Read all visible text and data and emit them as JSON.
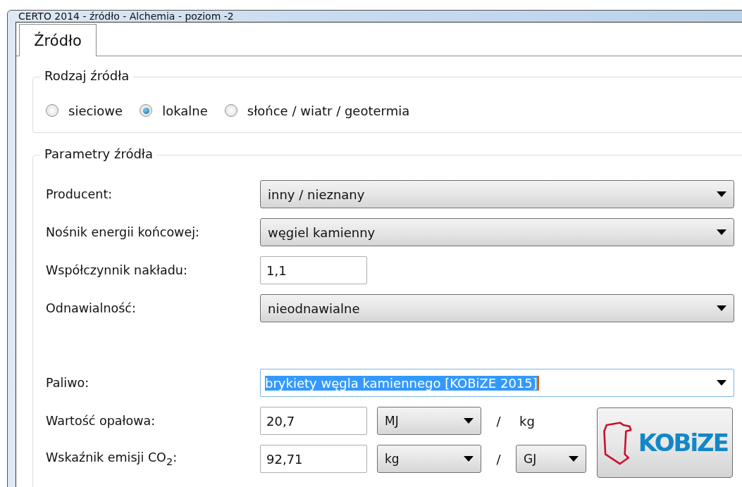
{
  "window": {
    "title": "CERTO 2014 - źródło - Alchemia - poziom -2"
  },
  "tabs": [
    {
      "label": "Źródło",
      "selected": true
    }
  ],
  "source_type": {
    "legend": "Rodzaj źródła",
    "options": [
      {
        "label": "sieciowe",
        "selected": false
      },
      {
        "label": "lokalne",
        "selected": true
      },
      {
        "label": "słońce / wiatr / geotermia",
        "selected": false
      }
    ]
  },
  "parameters": {
    "legend": "Parametry źródła",
    "fields": [
      {
        "kind": "dropdown",
        "label": "Producent:",
        "value": "inny / nieznany"
      },
      {
        "kind": "dropdown",
        "label": "Nośnik energii końcowej:",
        "value": "węgiel kamienny"
      },
      {
        "kind": "input",
        "label": "Współczynnik nakładu:",
        "value": "1,1"
      },
      {
        "kind": "dropdown",
        "label": "Odnawialność:",
        "value": "nieodnawialne"
      },
      {
        "kind": "combo",
        "label": "Paliwo:",
        "value": "brykiety węgla kamiennego [KOBiZE 2015]",
        "text_selected": true
      }
    ],
    "heating_value": {
      "label": "Wartość opałowa:",
      "value": "20,7",
      "unit": "MJ",
      "separator": "/",
      "per_unit": "kg"
    },
    "emission": {
      "label": "Wskaźnik emisji CO$_{2}$:",
      "value": "92,71",
      "unit": "kg",
      "separator": "/",
      "per_unit": "GJ"
    },
    "kobize_button": {
      "text": "KOBiZE"
    }
  }
}
